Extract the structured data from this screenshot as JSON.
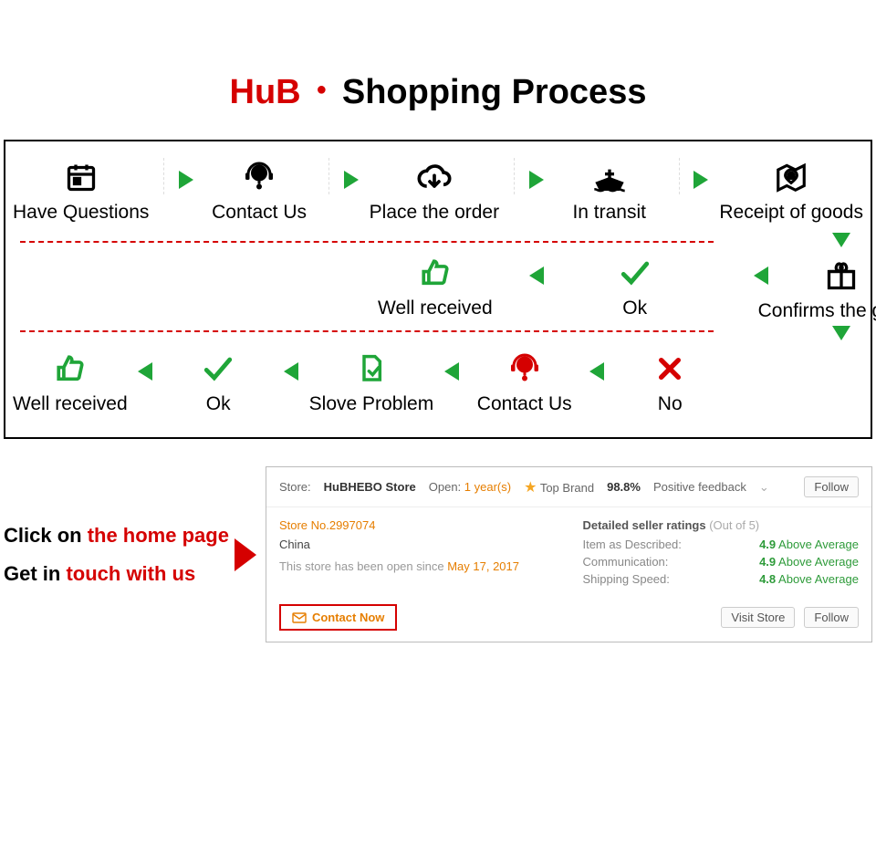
{
  "title": {
    "brand": "HuB",
    "rest": "Shopping Process"
  },
  "flow": {
    "row1": [
      {
        "label": "Have Questions"
      },
      {
        "label": "Contact Us"
      },
      {
        "label": "Place the order"
      },
      {
        "label": "In transit"
      },
      {
        "label": "Receipt of goods"
      }
    ],
    "row2": [
      {
        "label": "Well received"
      },
      {
        "label": "Ok"
      }
    ],
    "confirm": "Confirms the goods",
    "row3": [
      {
        "label": "Well received"
      },
      {
        "label": "Ok"
      },
      {
        "label": "Slove Problem"
      },
      {
        "label": "Contact Us"
      },
      {
        "label": "No"
      }
    ]
  },
  "instr": {
    "l1a": "Click on ",
    "l1b": "the home page",
    "l2a": "Get in ",
    "l2b": "touch with us"
  },
  "store": {
    "store_label": "Store:",
    "store_name": "HuBHEBO Store",
    "open_label": "Open:",
    "open_value": "1 year(s)",
    "topbrand": "Top Brand",
    "feedback_pct": "98.8%",
    "feedback_label": "Positive feedback",
    "follow": "Follow",
    "store_no": "Store No.2997074",
    "country": "China",
    "since_pre": "This store has been open since ",
    "since_date": "May 17, 2017",
    "ratings_title": "Detailed seller ratings",
    "ratings_sub": "(Out of 5)",
    "ratings": [
      {
        "label": "Item as Described:",
        "score": "4.9",
        "note": "Above Average"
      },
      {
        "label": "Communication:",
        "score": "4.9",
        "note": "Above Average"
      },
      {
        "label": "Shipping Speed:",
        "score": "4.8",
        "note": "Above Average"
      }
    ],
    "contact_now": "Contact Now",
    "visit": "Visit Store",
    "follow2": "Follow"
  }
}
